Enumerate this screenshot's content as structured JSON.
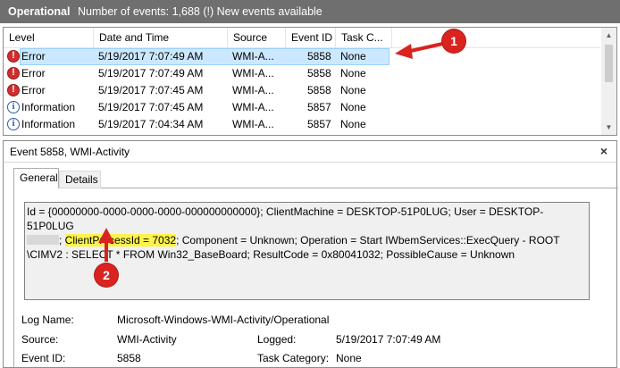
{
  "title": {
    "log": "Operational",
    "info": "Number of events: 1,688 (!) New events available"
  },
  "events": {
    "columns": [
      "Level",
      "Date and Time",
      "Source",
      "Event ID",
      "Task C..."
    ],
    "rows": [
      {
        "icon": "error-icon",
        "level": "Error",
        "date": "5/19/2017 7:07:49 AM",
        "source": "WMI-A...",
        "id": "5858",
        "task": "None"
      },
      {
        "icon": "error-icon",
        "level": "Error",
        "date": "5/19/2017 7:07:49 AM",
        "source": "WMI-A...",
        "id": "5858",
        "task": "None"
      },
      {
        "icon": "error-icon",
        "level": "Error",
        "date": "5/19/2017 7:07:45 AM",
        "source": "WMI-A...",
        "id": "5858",
        "task": "None"
      },
      {
        "icon": "info-icon",
        "level": "Information",
        "date": "5/19/2017 7:07:45 AM",
        "source": "WMI-A...",
        "id": "5857",
        "task": "None"
      },
      {
        "icon": "info-icon",
        "level": "Information",
        "date": "5/19/2017 7:04:34 AM",
        "source": "WMI-A...",
        "id": "5857",
        "task": "None"
      }
    ]
  },
  "details": {
    "title": "Event 5858, WMI-Activity",
    "close": "×",
    "tabs": [
      "General",
      "Details"
    ],
    "message": {
      "line1": "Id = {00000000-0000-0000-0000-000000000000}; ClientMachine = DESKTOP-51P0LUG; User = DESKTOP-51P0LUG",
      "line2_pre": "; ",
      "line2_hl": "ClientProcessId = 7032",
      "line2_post": "; Component = Unknown; Operation = Start IWbemServices::ExecQuery - ROOT",
      "line3": "\\CIMV2 : SELECT * FROM Win32_BaseBoard; ResultCode = 0x80041032; PossibleCause = Unknown"
    },
    "props": {
      "log_name_label": "Log Name:",
      "log_name": "Microsoft-Windows-WMI-Activity/Operational",
      "source_label": "Source:",
      "source": "WMI-Activity",
      "logged_label": "Logged:",
      "logged": "5/19/2017 7:07:49 AM",
      "event_id_label": "Event ID:",
      "event_id": "5858",
      "task_label": "Task Category:",
      "task": "None"
    }
  },
  "annotations": {
    "badge1": "1",
    "badge2": "2",
    "color": "#d9231f"
  }
}
